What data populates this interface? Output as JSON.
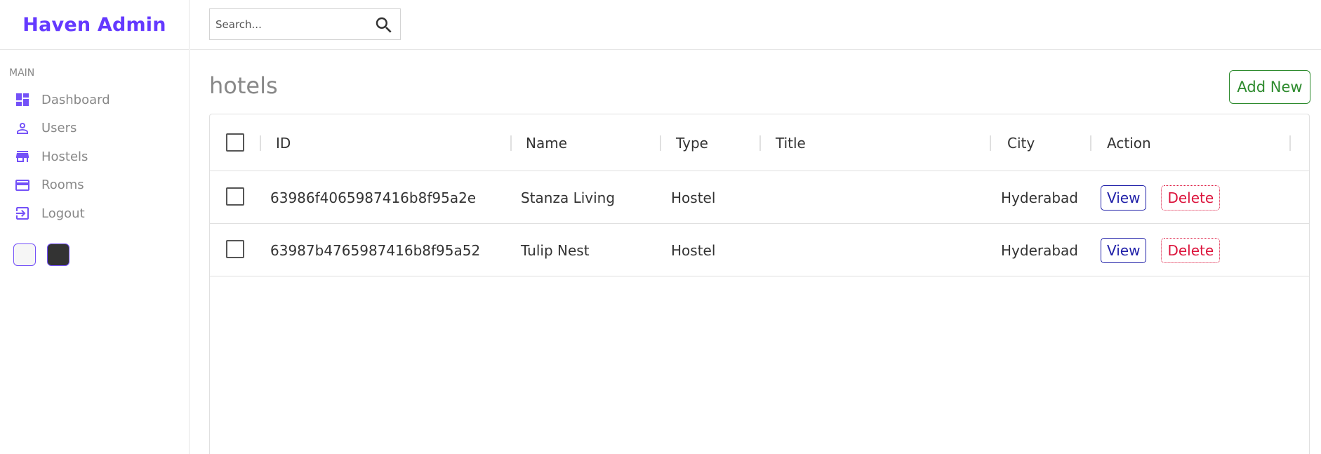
{
  "app": {
    "title": "Haven Admin"
  },
  "sidebar": {
    "section_title": "MAIN",
    "items": [
      {
        "label": "Dashboard",
        "icon": "dashboard-icon"
      },
      {
        "label": "Users",
        "icon": "person-icon"
      },
      {
        "label": "Hostels",
        "icon": "store-icon"
      },
      {
        "label": "Rooms",
        "icon": "credit-card-icon"
      },
      {
        "label": "Logout",
        "icon": "exit-icon"
      }
    ],
    "theme_options": [
      "light",
      "dark"
    ]
  },
  "topbar": {
    "search_placeholder": "Search..."
  },
  "main": {
    "title": "hotels",
    "add_new_label": "Add New",
    "table": {
      "columns": [
        "ID",
        "Name",
        "Type",
        "Title",
        "City",
        "Action"
      ],
      "rows": [
        {
          "id": "63986f4065987416b8f95a2e",
          "name": "Stanza Living",
          "type": "Hostel",
          "title": "",
          "city": "Hyderabad",
          "view": "View",
          "delete": "Delete"
        },
        {
          "id": "63987b4765987416b8f95a52",
          "name": "Tulip Nest",
          "type": "Hostel",
          "title": "",
          "city": "Hyderabad",
          "view": "View",
          "delete": "Delete"
        }
      ]
    }
  },
  "colors": {
    "brand": "#6439ff",
    "icon": "#7451f8",
    "add_new": "#2e8b2e",
    "view": "#1f1fa8",
    "delete": "#dc143c"
  }
}
